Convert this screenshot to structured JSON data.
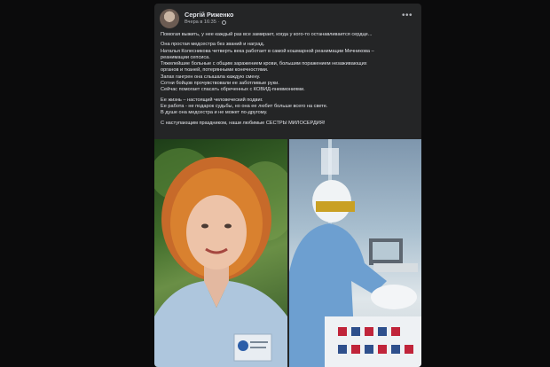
{
  "post": {
    "author": "Сергій Риженко",
    "timestamp": "Вчера в 16:35",
    "privacy_separator": "·",
    "more_menu": "•••",
    "paragraphs": [
      [
        "Помогая выжить, у нее каждый раз все замирает, когда у кого-то останавливается сердце..."
      ],
      [
        "Она простая медсестра без званий и наград.",
        "Наталья Колесникова четверть века работает в самой кошмарной реанимации Мечникова –",
        "реанимации сепсиса.",
        "Тяжелейшие больные с общим заражением крови, большим поражением незаживающих",
        "органов и тканей, потерянными конечностями.",
        "Запах гангрен она слышала каждую смену.",
        "Сотни бойцов прочувствовали ее заботливые руки.",
        "Сейчас помогает спасать обреченных с КОВИД-пневмониями."
      ],
      [
        "Ее жизнь –  настоящий человеческий подвиг.",
        "Ее работа - не подарок судьбы, но она ее любит больше всего на свете.",
        "В душе она медсестра и не может по-другому."
      ],
      [
        "С наступающим праздником, наши любимые СЕСТРЫ МИЛОСЕРДИЯ!"
      ]
    ]
  },
  "icons": {
    "privacy": "globe-icon",
    "more": "more-options-icon"
  },
  "colors": {
    "page_background": "#0b0b0c",
    "post_background": "#242526",
    "text_primary": "#e4e6eb",
    "text_secondary": "#b0b3b8"
  }
}
